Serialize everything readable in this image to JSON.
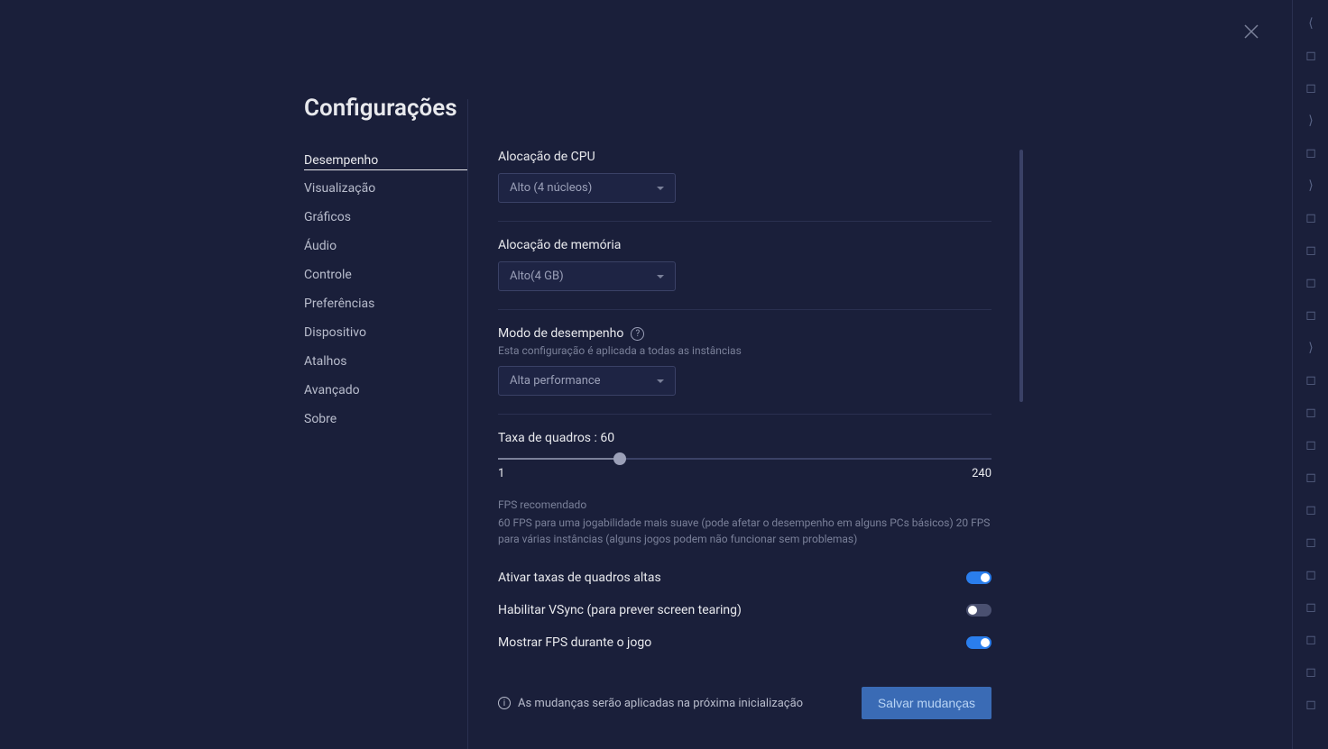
{
  "page": {
    "title": "Configurações"
  },
  "sidebar": {
    "items": [
      {
        "label": "Desempenho",
        "active": true
      },
      {
        "label": "Visualização",
        "active": false
      },
      {
        "label": "Gráficos",
        "active": false
      },
      {
        "label": "Áudio",
        "active": false
      },
      {
        "label": "Controle",
        "active": false
      },
      {
        "label": "Preferências",
        "active": false
      },
      {
        "label": "Dispositivo",
        "active": false
      },
      {
        "label": "Atalhos",
        "active": false
      },
      {
        "label": "Avançado",
        "active": false
      },
      {
        "label": "Sobre",
        "active": false
      }
    ]
  },
  "cpu": {
    "label": "Alocação de CPU",
    "value": "Alto (4 núcleos)"
  },
  "memory": {
    "label": "Alocação de memória",
    "value": "Alto(4 GB)"
  },
  "performance_mode": {
    "label": "Modo de desempenho",
    "sublabel": "Esta configuração é aplicada a todas as instâncias",
    "value": "Alta performance"
  },
  "framerate": {
    "label": "Taxa de quadros : 60",
    "min": "1",
    "max": "240",
    "recommended_title": "FPS recomendado",
    "recommended_text": "60 FPS para uma jogabilidade mais suave (pode afetar o desempenho em alguns PCs básicos) 20 FPS para várias instâncias (alguns jogos podem não funcionar sem problemas)"
  },
  "toggles": {
    "high_framerate": {
      "label": "Ativar taxas de quadros altas",
      "on": true
    },
    "vsync": {
      "label": "Habilitar VSync (para prever screen tearing)",
      "on": false
    },
    "show_fps": {
      "label": "Mostrar FPS durante o jogo",
      "on": true
    }
  },
  "footer": {
    "notice": "As mudanças serão aplicadas na próxima inicialização",
    "save_label": "Salvar mudanças"
  }
}
